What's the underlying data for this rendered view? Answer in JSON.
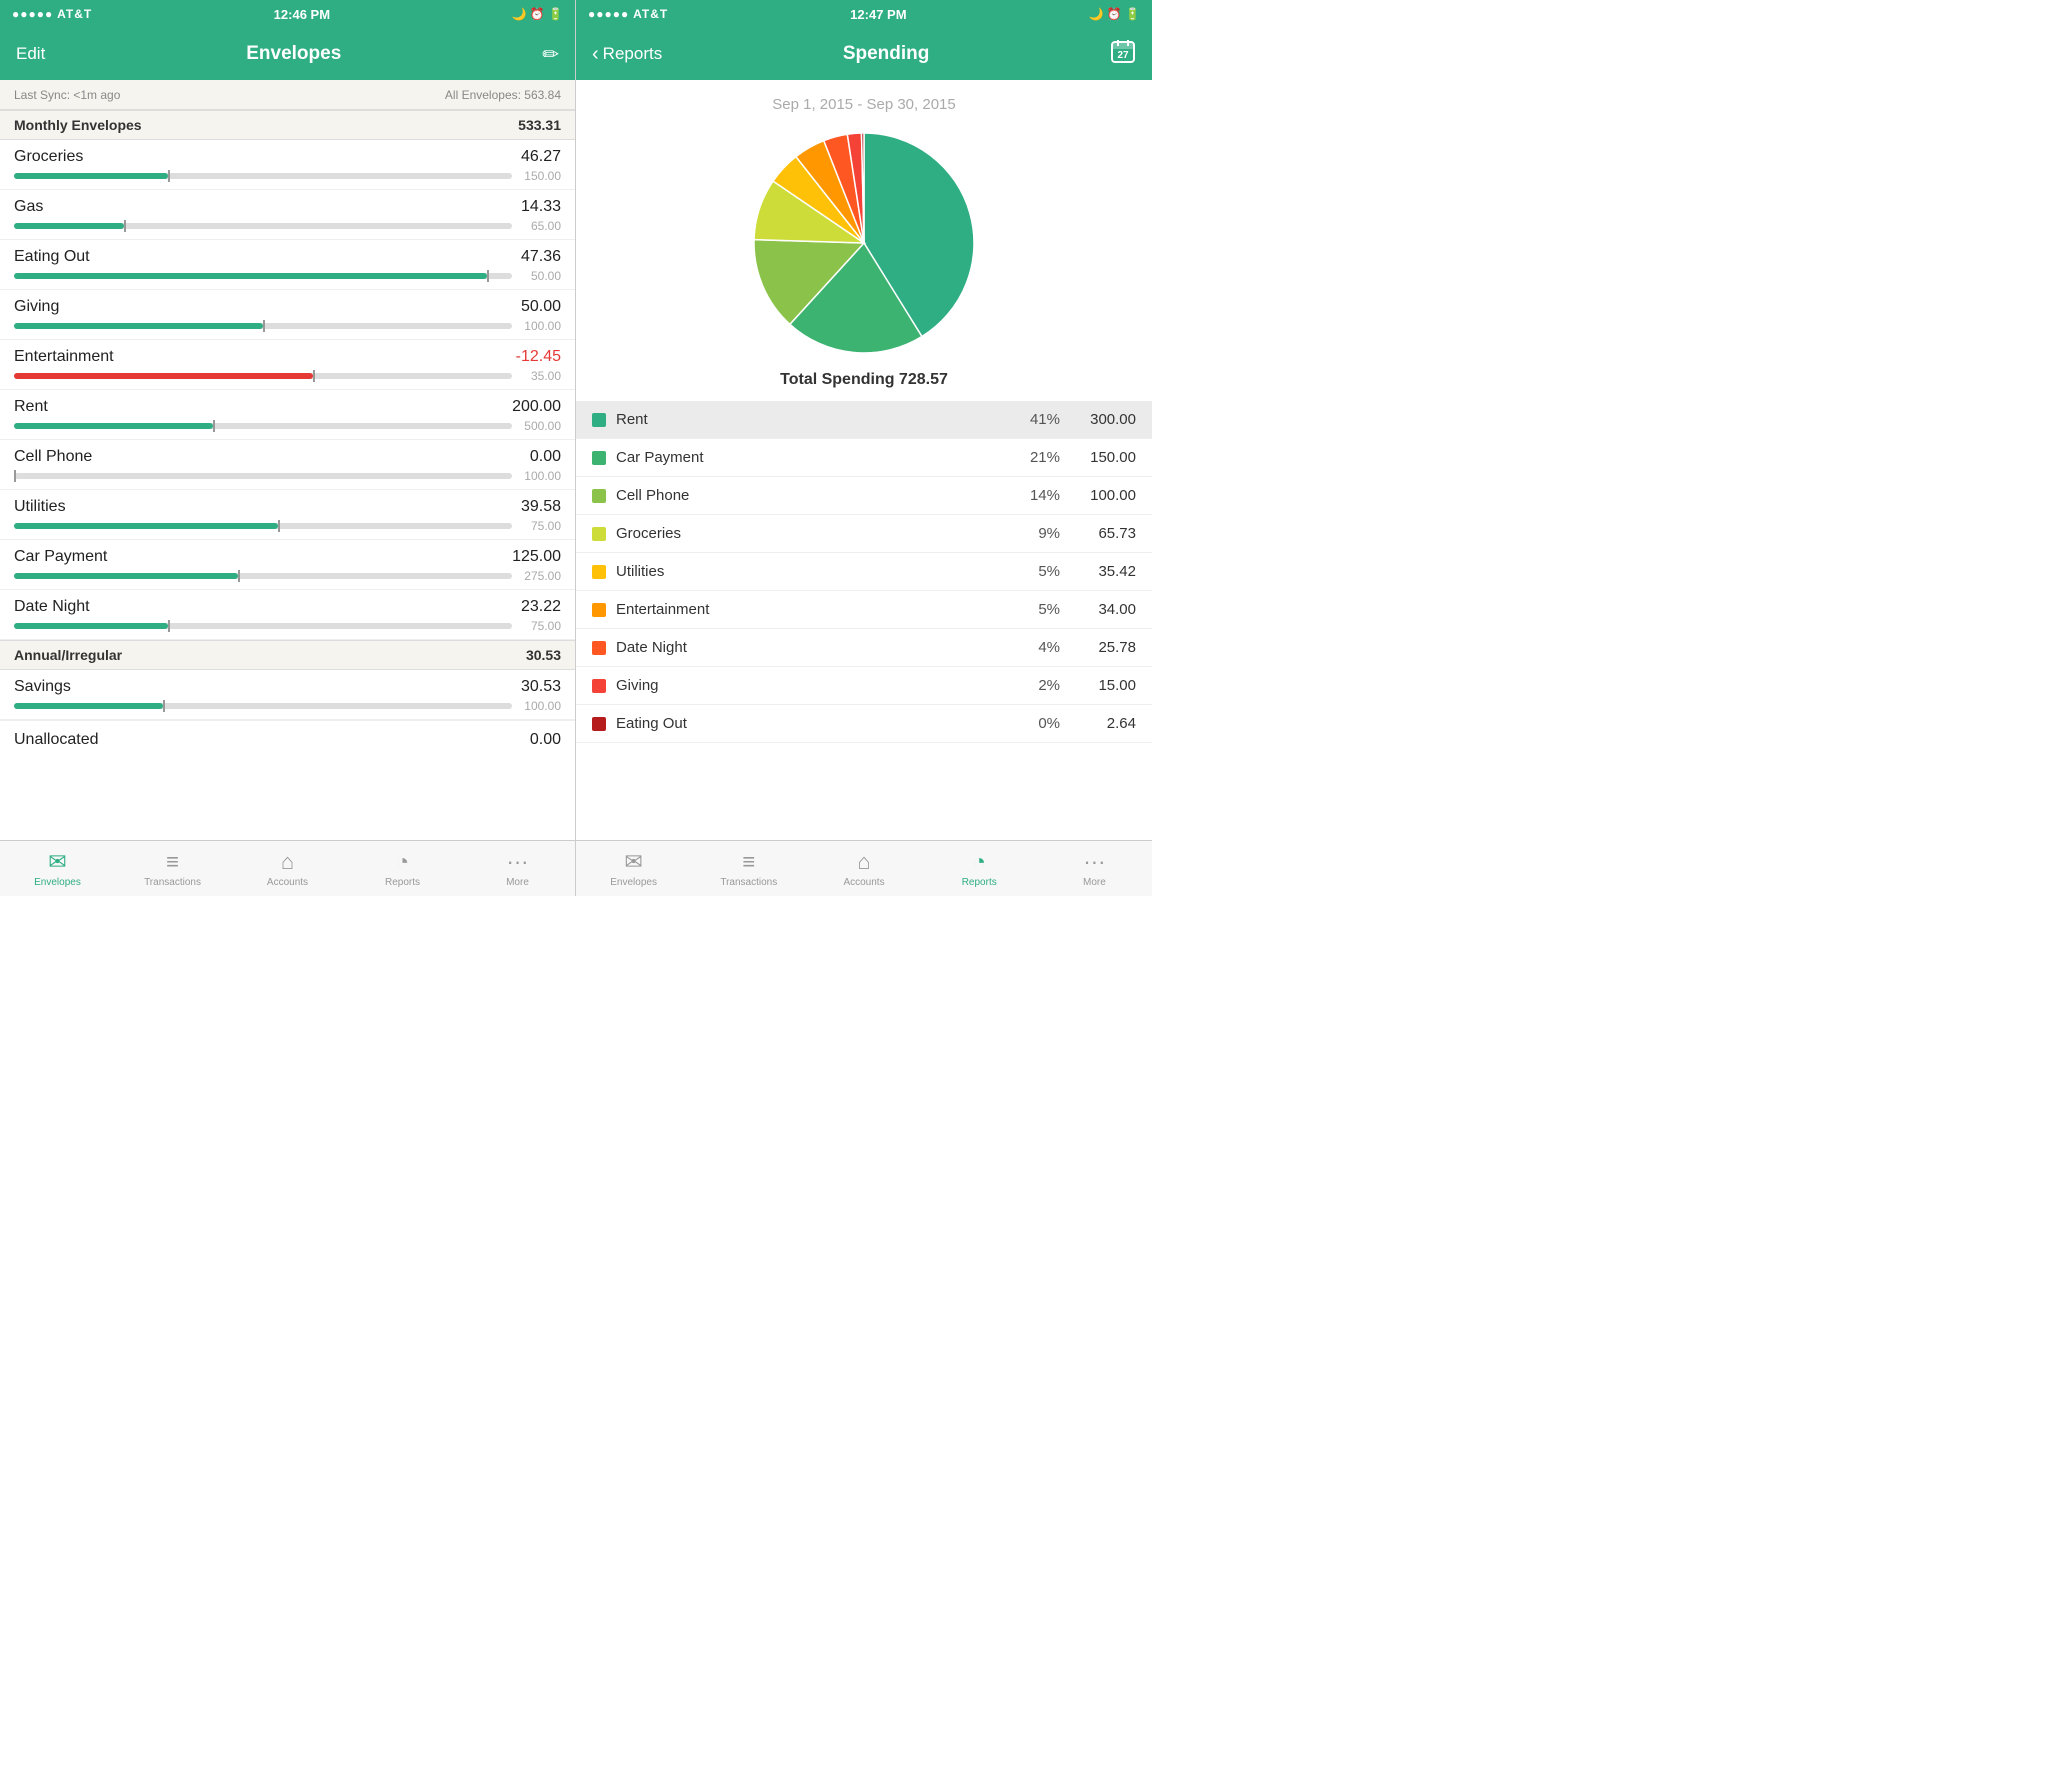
{
  "left": {
    "status": {
      "carrier": "●●●●● AT&T",
      "wifi": "▲",
      "time": "12:46 PM",
      "icons": "🌙 ⏰ 🔋"
    },
    "nav": {
      "edit": "Edit",
      "title": "Envelopes",
      "icon": "✏️"
    },
    "sync": {
      "last_sync": "Last Sync: <1m ago",
      "all_envelopes": "All Envelopes: 563.84"
    },
    "monthly": {
      "label": "Monthly Envelopes",
      "amount": "533.31"
    },
    "envelopes": [
      {
        "name": "Groceries",
        "amount": "46.27",
        "budget": "150.00",
        "pct": 31,
        "negative": false
      },
      {
        "name": "Gas",
        "amount": "14.33",
        "budget": "65.00",
        "pct": 22,
        "negative": false
      },
      {
        "name": "Eating Out",
        "amount": "47.36",
        "budget": "50.00",
        "pct": 95,
        "negative": false
      },
      {
        "name": "Giving",
        "amount": "50.00",
        "budget": "100.00",
        "pct": 50,
        "negative": false
      },
      {
        "name": "Entertainment",
        "amount": "-12.45",
        "budget": "35.00",
        "pct": 60,
        "negative": true
      },
      {
        "name": "Rent",
        "amount": "200.00",
        "budget": "500.00",
        "pct": 40,
        "negative": false
      },
      {
        "name": "Cell Phone",
        "amount": "0.00",
        "budget": "100.00",
        "pct": 0,
        "negative": false
      },
      {
        "name": "Utilities",
        "amount": "39.58",
        "budget": "75.00",
        "pct": 53,
        "negative": false
      },
      {
        "name": "Car Payment",
        "amount": "125.00",
        "budget": "275.00",
        "pct": 45,
        "negative": false
      },
      {
        "name": "Date Night",
        "amount": "23.22",
        "budget": "75.00",
        "pct": 31,
        "negative": false
      }
    ],
    "annual": {
      "label": "Annual/Irregular",
      "amount": "30.53"
    },
    "savings_envelopes": [
      {
        "name": "Savings",
        "amount": "30.53",
        "budget": "100.00",
        "pct": 30,
        "negative": false
      }
    ],
    "unallocated": {
      "label": "Unallocated",
      "amount": "0.00"
    },
    "tabs": [
      {
        "icon": "✉",
        "label": "Envelopes",
        "active": true
      },
      {
        "icon": "≡",
        "label": "Transactions",
        "active": false
      },
      {
        "icon": "⌂",
        "label": "Accounts",
        "active": false
      },
      {
        "icon": "◔",
        "label": "Reports",
        "active": false
      },
      {
        "icon": "···",
        "label": "More",
        "active": false
      }
    ]
  },
  "right": {
    "status": {
      "carrier": "●●●●● AT&T",
      "wifi": "▲",
      "time": "12:47 PM",
      "icons": "🌙 ⏰ 🔋"
    },
    "nav": {
      "back": "Reports",
      "title": "Spending",
      "calendar": "27"
    },
    "chart": {
      "date_range": "Sep 1, 2015 - Sep 30, 2015",
      "total_label": "Total Spending 728.57"
    },
    "spending": [
      {
        "name": "Rent",
        "pct": "41%",
        "amount": "300.00",
        "color": "#2EAE82"
      },
      {
        "name": "Car Payment",
        "pct": "21%",
        "amount": "150.00",
        "color": "#3CB371"
      },
      {
        "name": "Cell Phone",
        "pct": "14%",
        "amount": "100.00",
        "color": "#8BC34A"
      },
      {
        "name": "Groceries",
        "pct": "9%",
        "amount": "65.73",
        "color": "#CDDC39"
      },
      {
        "name": "Utilities",
        "pct": "5%",
        "amount": "35.42",
        "color": "#FFC107"
      },
      {
        "name": "Entertainment",
        "pct": "5%",
        "amount": "34.00",
        "color": "#FF9800"
      },
      {
        "name": "Date Night",
        "pct": "4%",
        "amount": "25.78",
        "color": "#FF5722"
      },
      {
        "name": "Giving",
        "pct": "2%",
        "amount": "15.00",
        "color": "#F44336"
      },
      {
        "name": "Eating Out",
        "pct": "0%",
        "amount": "2.64",
        "color": "#B71C1C"
      }
    ],
    "tabs": [
      {
        "icon": "✉",
        "label": "Envelopes",
        "active": false
      },
      {
        "icon": "≡",
        "label": "Transactions",
        "active": false
      },
      {
        "icon": "⌂",
        "label": "Accounts",
        "active": false
      },
      {
        "icon": "◔",
        "label": "Reports",
        "active": true
      },
      {
        "icon": "···",
        "label": "More",
        "active": false
      }
    ]
  }
}
